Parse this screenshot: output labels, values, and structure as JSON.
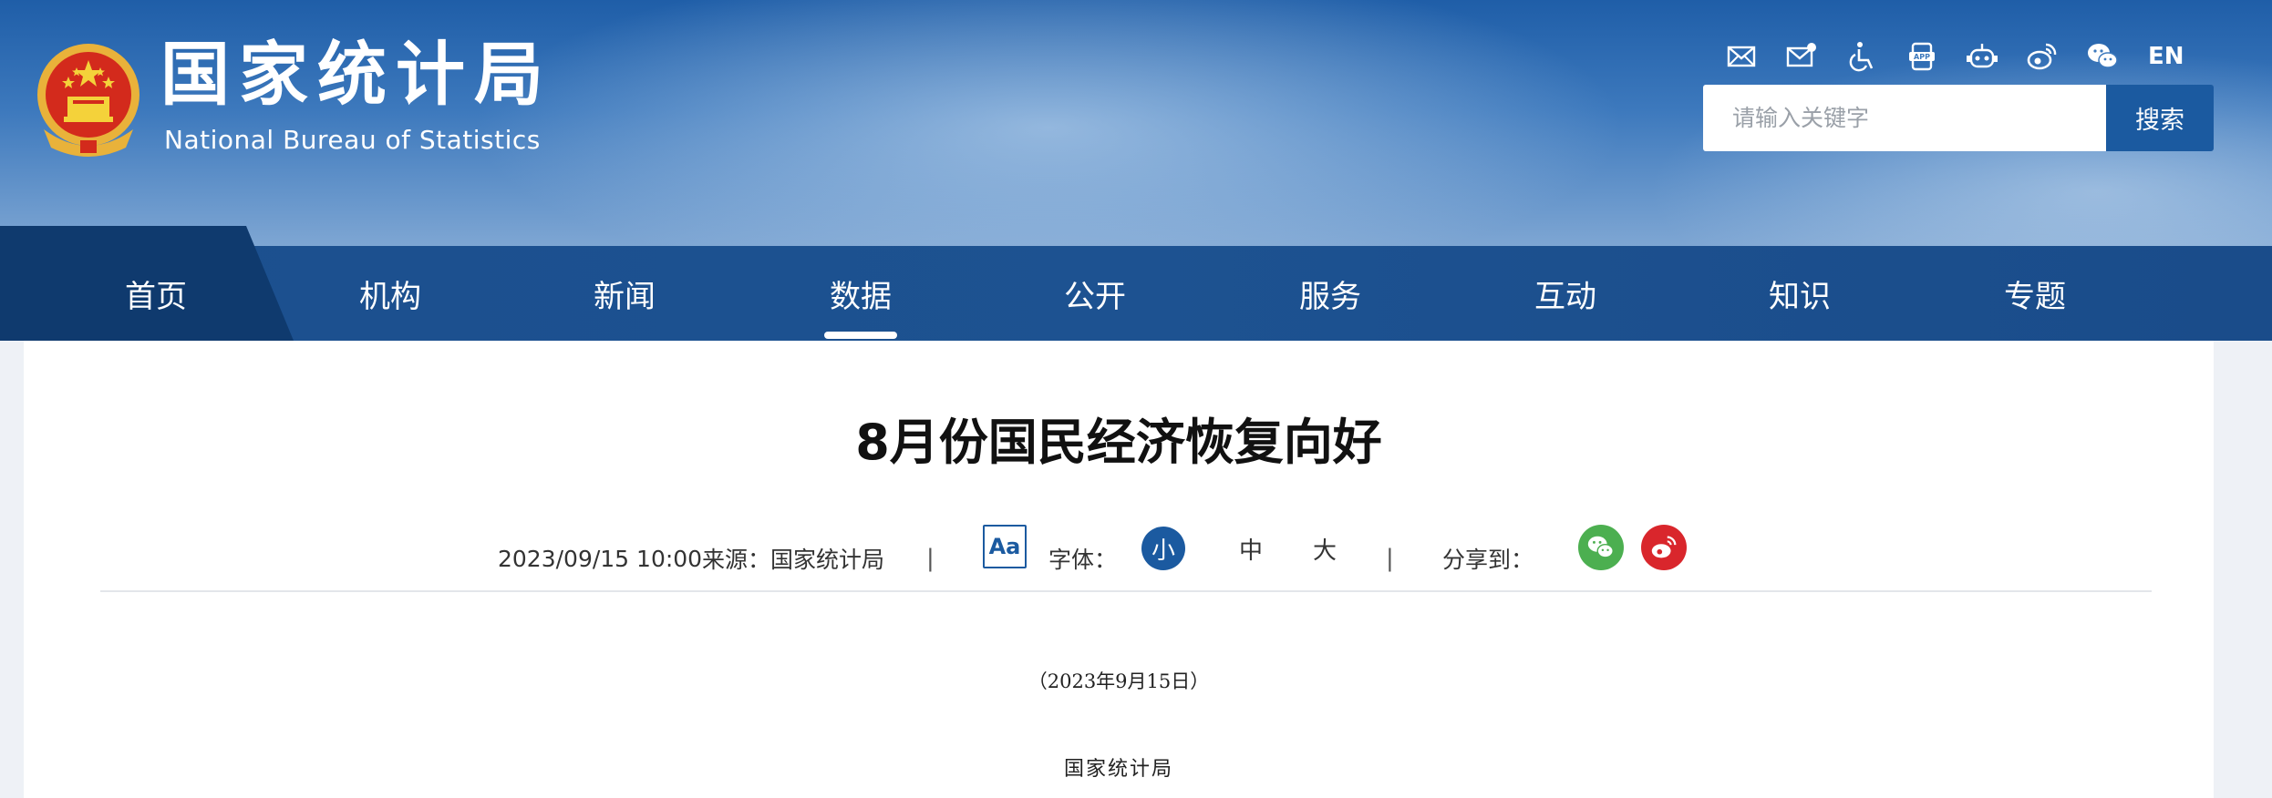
{
  "header": {
    "logo_cn": "国家统计局",
    "logo_en": "National Bureau of Statistics",
    "icons": [
      "mail-icon",
      "mail-settings-icon",
      "accessibility-icon",
      "app-icon",
      "robot-icon",
      "weibo-icon",
      "wechat-icon"
    ],
    "lang": "EN",
    "search_placeholder": "请输入关键字",
    "search_button": "搜索"
  },
  "nav": {
    "items": [
      "首页",
      "机构",
      "新闻",
      "数据",
      "公开",
      "服务",
      "互动",
      "知识",
      "专题"
    ],
    "active": "数据"
  },
  "article": {
    "title": "8月份国民经济恢复向好",
    "date": "2023/09/15 10:00",
    "source": "来源：国家统计局",
    "separator": "|",
    "aa": "Aa",
    "font_label": "字体：",
    "font_small": "小",
    "font_medium": "中",
    "font_large": "大",
    "share_label": "分享到：",
    "date_line": "（2023年9月15日）",
    "org_line": "国家统计局"
  },
  "colors": {
    "primary": "#1b5aa0",
    "nav": "#1b4f8e",
    "wechat": "#4caf50",
    "weibo": "#d9262c"
  }
}
